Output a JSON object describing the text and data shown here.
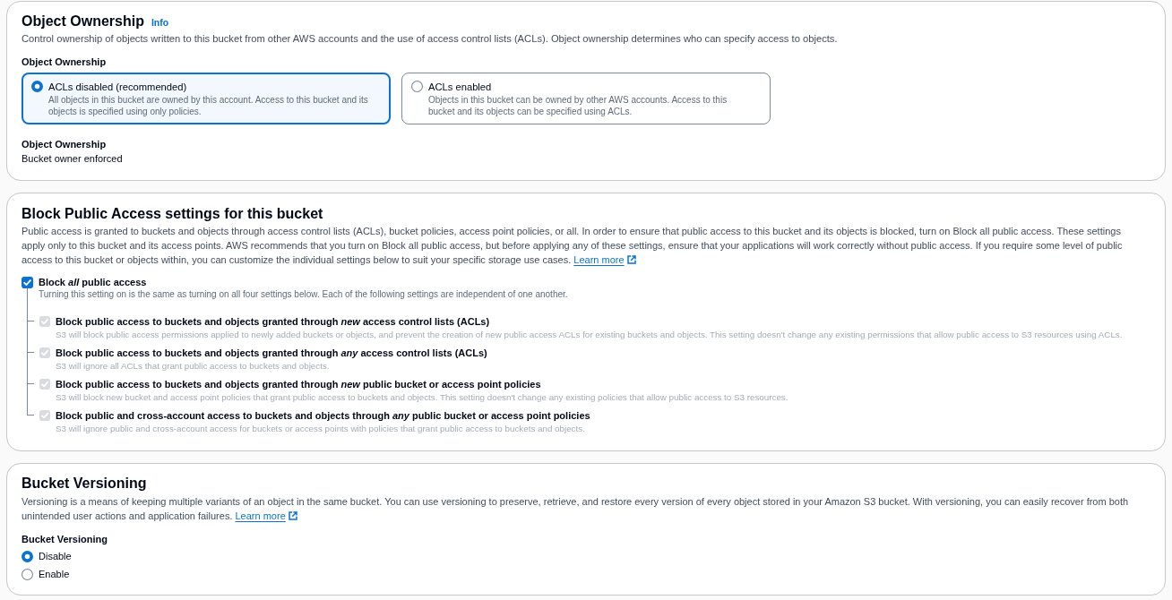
{
  "object_ownership": {
    "title": "Object Ownership",
    "info_link": "Info",
    "description": "Control ownership of objects written to this bucket from other AWS accounts and the use of access control lists (ACLs). Object ownership determines who can specify access to objects.",
    "field_label": "Object Ownership",
    "options": [
      {
        "label": "ACLs disabled (recommended)",
        "description": "All objects in this bucket are owned by this account. Access to this bucket and its objects is specified using only policies.",
        "selected": true
      },
      {
        "label": "ACLs enabled",
        "description": "Objects in this bucket can be owned by other AWS accounts. Access to this bucket and its objects can be specified using ACLs.",
        "selected": false
      }
    ],
    "summary": {
      "label": "Object Ownership",
      "value": "Bucket owner enforced"
    }
  },
  "block_public_access": {
    "title": "Block Public Access settings for this bucket",
    "description": "Public access is granted to buckets and objects through access control lists (ACLs), bucket policies, access point policies, or all. In order to ensure that public access to this bucket and its objects is blocked, turn on Block all public access. These settings apply only to this bucket and its access points. AWS recommends that you turn on Block all public access, but before applying any of these settings, ensure that your applications will work correctly without public access. If you require some level of public access to this bucket or objects within, you can customize the individual settings below to suit your specific storage use cases.",
    "learn_more": "Learn more",
    "block_all": {
      "label": "Block *all* public access",
      "description": "Turning this setting on is the same as turning on all four settings below. Each of the following settings are independent of one another.",
      "checked": true
    },
    "settings": [
      {
        "label": "Block public access to buckets and objects granted through *new* access control lists (ACLs)",
        "description": "S3 will block public access permissions applied to newly added buckets or objects, and prevent the creation of new public access ACLs for existing buckets and objects. This setting doesn't change any existing permissions that allow public access to S3 resources using ACLs.",
        "checked": true,
        "disabled": true
      },
      {
        "label": "Block public access to buckets and objects granted through *any* access control lists (ACLs)",
        "description": "S3 will ignore all ACLs that grant public access to buckets and objects.",
        "checked": true,
        "disabled": true
      },
      {
        "label": "Block public access to buckets and objects granted through *new* public bucket or access point policies",
        "description": "S3 will block new bucket and access point policies that grant public access to buckets and objects. This setting doesn't change any existing policies that allow public access to S3 resources.",
        "checked": true,
        "disabled": true
      },
      {
        "label": "Block public and cross-account access to buckets and objects through *any* public bucket or access point policies",
        "description": "S3 will ignore public and cross-account access for buckets or access points with policies that grant public access to buckets and objects.",
        "checked": true,
        "disabled": true
      }
    ]
  },
  "bucket_versioning": {
    "title": "Bucket Versioning",
    "description": "Versioning is a means of keeping multiple variants of an object in the same bucket. You can use versioning to preserve, retrieve, and restore every version of every object stored in your Amazon S3 bucket. With versioning, you can easily recover from both unintended user actions and application failures.",
    "learn_more": "Learn more",
    "field_label": "Bucket Versioning",
    "options": [
      {
        "label": "Disable",
        "selected": true
      },
      {
        "label": "Enable",
        "selected": false
      }
    ]
  }
}
